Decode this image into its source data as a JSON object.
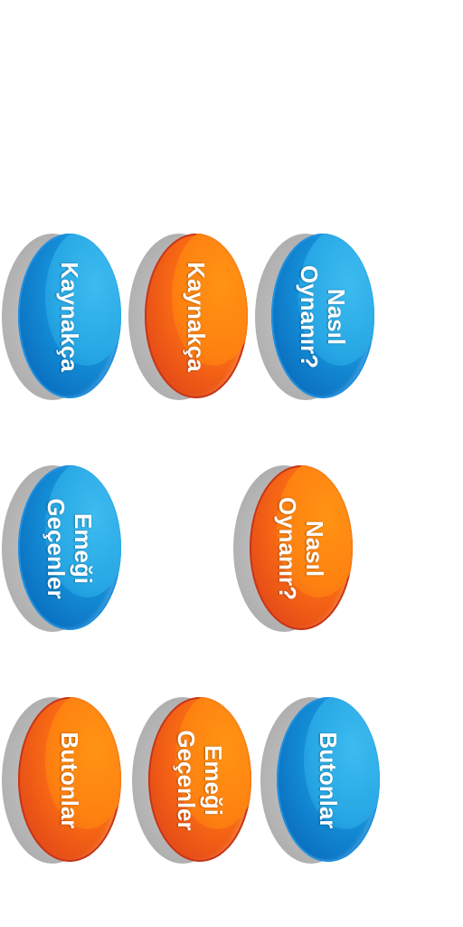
{
  "colors": {
    "blue": "#1692da",
    "orange": "#f86a14",
    "shadow": "#b9b9b9",
    "text": "#ffffff"
  },
  "buttons": {
    "kaynakca_blue": {
      "lines": [
        "Kaynakça"
      ]
    },
    "kaynakca_orange": {
      "lines": [
        "Kaynakça"
      ]
    },
    "nasil_blue": {
      "lines": [
        "Nasıl",
        "Oynanır?"
      ]
    },
    "emegi_blue": {
      "lines": [
        "Emeği",
        "Geçenler"
      ]
    },
    "nasil_orange": {
      "lines": [
        "Nasıl",
        "Oynanır?"
      ]
    },
    "butonlar_orange": {
      "lines": [
        "Butonlar"
      ]
    },
    "emegi_orange": {
      "lines": [
        "Emeği",
        "Geçenler"
      ]
    },
    "butonlar_blue": {
      "lines": [
        "Butonlar"
      ]
    }
  }
}
